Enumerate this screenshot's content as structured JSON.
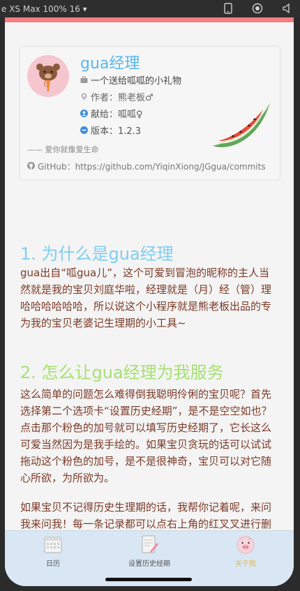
{
  "devtools": {
    "title": "e XS Max 100% 16 ▾"
  },
  "profile": {
    "name": "gua经理",
    "slogan": "一个送给呱呱的小礼物",
    "author": "作者：熊老板♂",
    "gift_to": "献给：呱呱♀",
    "version": "版本：1.2.3",
    "motto": "—— 爱你就像爱生命",
    "github": "GitHub：https://github.com/YiqinXiong/JGgua/commits"
  },
  "article": {
    "h1": "1. 为什么是gua经理",
    "p1": "gua出自“呱gua儿”，这个可爱到冒泡的昵称的主人当然就是我的宝贝刘庭华啦，经理就是（月）经（管）理哈哈哈哈哈哈，所以说这个小程序就是熊老板出品的专为我的宝贝老婆记生理期的小工具~",
    "h2": "2. 怎么让gua经理为我服务",
    "p2": "这么简单的问题怎么难得倒我聪明伶俐的宝贝呢？首先选择第二个选项卡“设置历史经期”，是不是空空如也？点击那个粉色的加号就可以填写历史经期了，它长这么可爱当然因为是我手绘的。如果宝贝贪玩的话可以试试拖动这个粉色的加号，是不是很神奇，宝贝可以对它随心所欲，为所欲为。",
    "p3": "如果宝贝不记得历史生理期的话，我帮你记着呢，来问我来问我！每一条记录都可以点右上角的红叉叉进行删除，各条记录会按时间顺序自动进行排序，所以"
  },
  "tabs": [
    {
      "label": "日历",
      "icon": "calendar-icon"
    },
    {
      "label": "设置历史经期",
      "icon": "edit-notes-icon"
    },
    {
      "label": "关于我",
      "icon": "pig-face-icon"
    }
  ],
  "colors": {
    "accent_pink": "#f57e84",
    "title_blue": "#58b6ee",
    "h1_blue": "#7fcdf0",
    "h2_green": "#a6e073",
    "text_brown": "#7b3a28",
    "tab_active": "#e8b64d",
    "tabbar_bg": "#d9e7f4"
  }
}
